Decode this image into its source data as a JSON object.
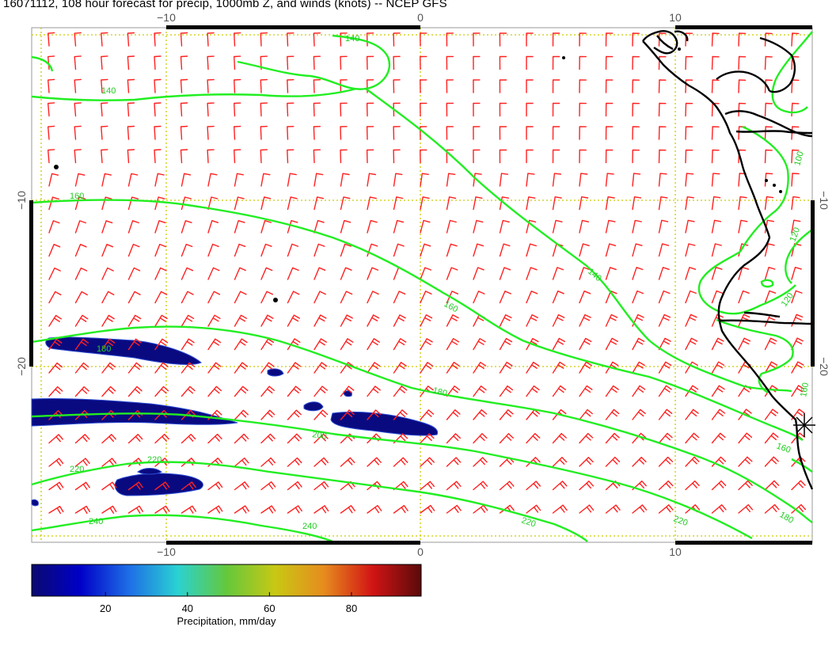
{
  "title": "16071112, 108 hour forecast for precip, 1000mb Z, and winds (knots) -- NCEP GFS",
  "axes": {
    "top_ticks": [
      "−10",
      "0",
      "10"
    ],
    "bottom_ticks": [
      "−10",
      "0",
      "10"
    ],
    "left_ticks": [
      "−10",
      "−20"
    ],
    "right_ticks": [
      "−10",
      "−20"
    ]
  },
  "map_extent": {
    "lon": [
      -15.3,
      15.4
    ],
    "lat": [
      -26.2,
      1.0
    ]
  },
  "colors": {
    "wind_barb": "#ff2020",
    "height_contour": "#22ee22",
    "coastline": "#000000",
    "graticule": "#cccc00",
    "precip_low": "#0a0a80"
  },
  "height_contours": {
    "labels": [
      "140",
      "140",
      "160",
      "160",
      "140",
      "180",
      "180",
      "200",
      "220",
      "220",
      "240",
      "220",
      "240",
      "220",
      "160",
      "100",
      "120",
      "120",
      "160",
      "180"
    ]
  },
  "colorbar": {
    "range": [
      2,
      97
    ],
    "ticks": [
      "20",
      "40",
      "60",
      "80"
    ],
    "label": "Precipitation, mm/day",
    "stops": [
      "#0a0a70",
      "#0000c8",
      "#1e6ee6",
      "#2ad2d2",
      "#64c83c",
      "#c8c814",
      "#e68c1e",
      "#d21414",
      "#5a0a0a"
    ]
  }
}
